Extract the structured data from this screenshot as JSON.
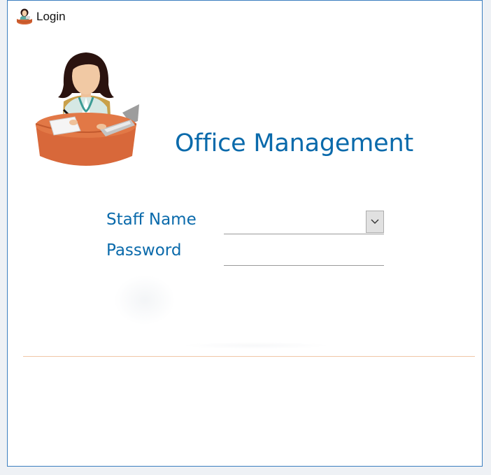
{
  "window": {
    "title": "Login",
    "app_icon": "office-worker-icon"
  },
  "hero": {
    "illustration": "office-worker-illustration",
    "app_title": "Office Management"
  },
  "form": {
    "staff_name_label": "Staff Name",
    "staff_name_value": "",
    "password_label": "Password",
    "password_value": "",
    "dropdown_icon": "chevron-down-icon"
  },
  "colors": {
    "accent": "#0a6aab",
    "desk": "#d8683a",
    "divider": "#f0c7a6",
    "window_border": "#3c7fc0"
  }
}
